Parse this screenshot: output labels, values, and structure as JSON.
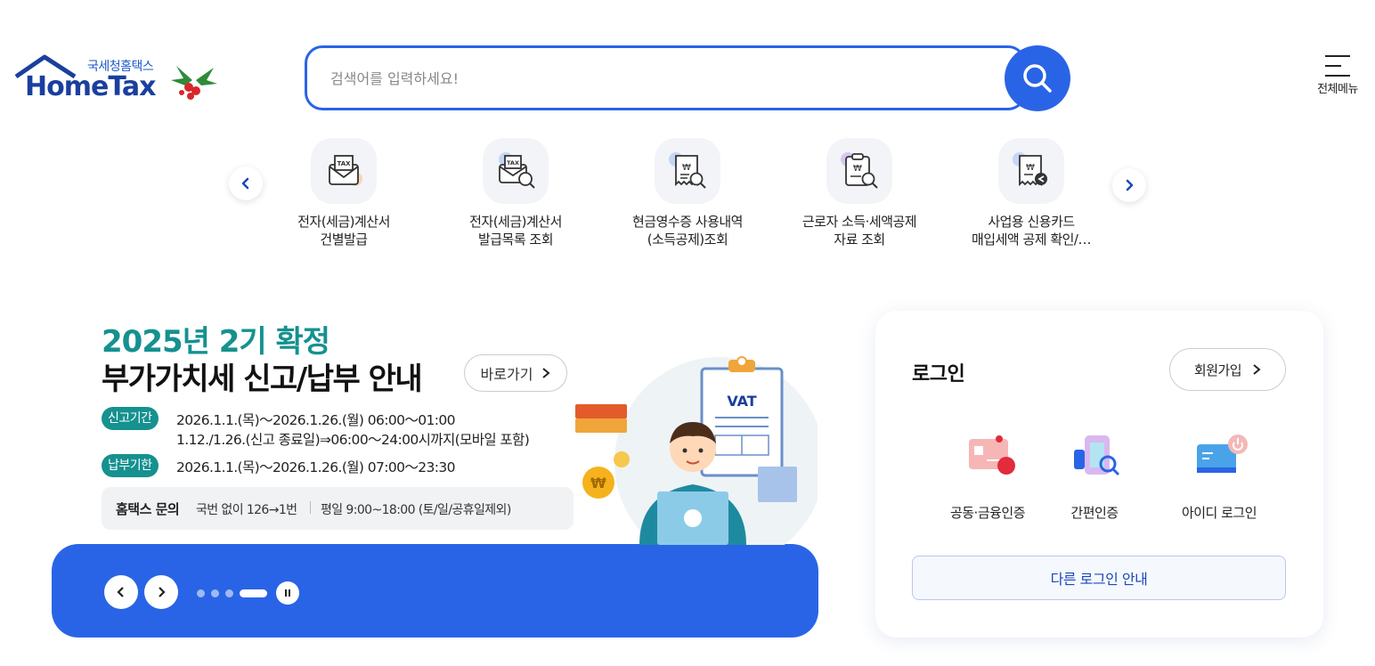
{
  "header": {
    "logo_sub": "국세청홈택스",
    "logo_main": "HomeTax",
    "search_placeholder": "검색어를 입력하세요!",
    "menu_label": "전체메뉴"
  },
  "quick_services": [
    {
      "label": "전자(세금)계산서\n건별발급",
      "icon": "tax-envelope-icon"
    },
    {
      "label": "전자(세금)계산서\n발급목록 조회",
      "icon": "tax-search-icon"
    },
    {
      "label": "현금영수증 사용내역\n(소득공제)조회",
      "icon": "receipt-search-icon"
    },
    {
      "label": "근로자 소득·세액공제\n자료 조회",
      "icon": "clipboard-search-icon"
    },
    {
      "label": "사업용 신용카드\n매입세액 공제 확인/…",
      "icon": "receipt-back-icon"
    }
  ],
  "banner": {
    "title1": "2025년 2기 확정",
    "title2": "부가가치세 신고/납부 안내",
    "go_label": "바로가기",
    "report_tag": "신고기간",
    "report_line1": "2026.1.1.(목)～2026.1.26.(월) 06:00～01:00",
    "report_line2": "1.12./1.26.(신고 종료일)⇒06:00～24:00시까지(모바일 포함)",
    "pay_tag": "납부기한",
    "pay_line": "2026.1.1.(목)～2026.1.26.(월) 07:00～23:30",
    "inquiry_title": "홈택스 문의",
    "inquiry_1": "국번 없이 126→1번",
    "inquiry_2": "평일 9:00~18:00 (토/일/공휴일제외)",
    "illus_label": "VAT",
    "slide_count": 4,
    "active_slide": 4
  },
  "login": {
    "title": "로그인",
    "signup_label": "회원가입",
    "options": [
      {
        "label": "공동·금융인증",
        "icon": "certificate-icon"
      },
      {
        "label": "간편인증",
        "icon": "simple-auth-icon"
      },
      {
        "label": "아이디 로그인",
        "icon": "id-login-icon"
      }
    ],
    "other_label": "다른 로그인 안내"
  },
  "colors": {
    "primary": "#2a64e6",
    "teal": "#159190",
    "navy": "#1a3f9e"
  }
}
